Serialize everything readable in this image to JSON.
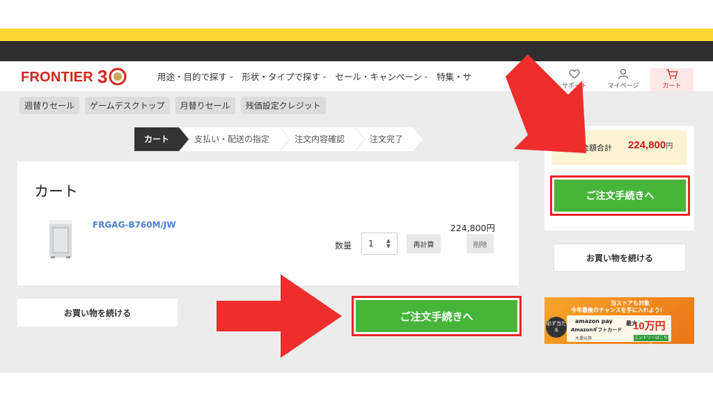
{
  "header": {
    "logo_text": "FRONTIER",
    "logo_badge": "30",
    "nav": [
      {
        "label": "用途・目的で探す"
      },
      {
        "label": "形状・タイプで探す"
      },
      {
        "label": "セール・キャンペーン"
      },
      {
        "label": "特集・サ"
      }
    ],
    "support_label": "サポート",
    "mypage_label": "マイページ",
    "cart_label": "カート"
  },
  "chips": [
    "週替りセール",
    "ゲームデスクトップ",
    "月替りセール",
    "残価設定クレジット"
  ],
  "steps": [
    "カート",
    "支払い・配送の指定",
    "注文内容確認",
    "注文完了"
  ],
  "cart": {
    "title": "カート",
    "product_name": "FRGAG-B760M/JW",
    "price": "224,800円",
    "qty_label": "数量",
    "qty_value": "1",
    "recalc_label": "再計算",
    "delete_label": "削除"
  },
  "continue_label": "お買い物を続ける",
  "order_label": "ご注文手続きへ",
  "summary": {
    "total_label": "注文金額合計",
    "total_value": "224,800",
    "yen": "円"
  },
  "banner": {
    "line1": "当ストアも対象",
    "line2": "今年最後のチャンスを手に入れよう！",
    "circle": "必ず当たる",
    "apay": "amazon pay",
    "gift": "Amazonギフトカード",
    "dai": "大還元祭",
    "max": "最大",
    "amount": "10万円",
    "entry": "エントリーはこちら"
  },
  "colors": {
    "brand_red": "#d5231d",
    "order_green": "#47b43a",
    "highlight_red": "#e82325",
    "price_red": "#c4181b",
    "link_blue": "#4d7fd6",
    "top_yellow": "#fcd733"
  }
}
